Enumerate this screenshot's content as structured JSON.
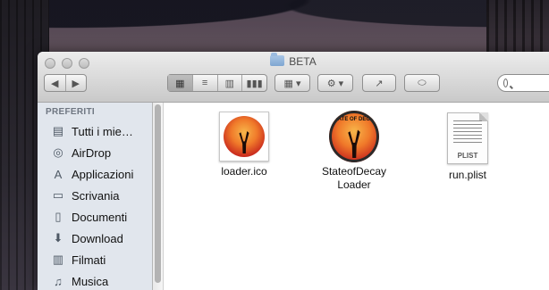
{
  "window": {
    "title": "BETA"
  },
  "toolbar": {
    "back_label": "◀",
    "forward_label": "▶",
    "view_icons_label": "▦",
    "view_list_label": "≡",
    "view_columns_label": "▥",
    "view_coverflow_label": "▮▮▮",
    "arrange_label": "▦ ▾",
    "action_label": "⚙ ▾",
    "share_label": "↗",
    "tags_label": "⬭"
  },
  "search": {
    "placeholder": ""
  },
  "sidebar": {
    "heading": "PREFERITI",
    "items": [
      {
        "label": "Tutti i mie…",
        "icon": "all-files-icon",
        "glyph": "▤"
      },
      {
        "label": "AirDrop",
        "icon": "airdrop-icon",
        "glyph": "◎"
      },
      {
        "label": "Applicazioni",
        "icon": "applications-icon",
        "glyph": "A"
      },
      {
        "label": "Scrivania",
        "icon": "desktop-icon",
        "glyph": "▭"
      },
      {
        "label": "Documenti",
        "icon": "documents-icon",
        "glyph": "▯"
      },
      {
        "label": "Download",
        "icon": "downloads-icon",
        "glyph": "⬇"
      },
      {
        "label": "Filmati",
        "icon": "movies-icon",
        "glyph": "▥"
      },
      {
        "label": "Musica",
        "icon": "music-icon",
        "glyph": "♫"
      }
    ]
  },
  "files": [
    {
      "name": "loader.ico",
      "icon": "ico-file-icon"
    },
    {
      "name_line1": "StateofDecay",
      "name_line2": "Loader",
      "icon": "app-icon",
      "badge": "STATE OF DECAY"
    },
    {
      "name": "run.plist",
      "icon": "plist-file-icon",
      "tag": "PLIST"
    }
  ]
}
